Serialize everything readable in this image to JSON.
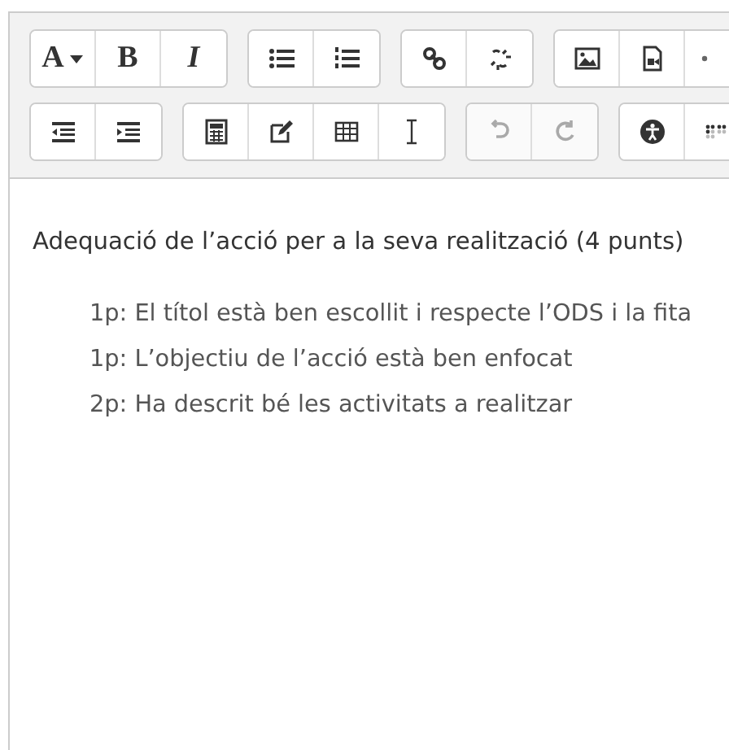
{
  "toolbar": {
    "rows": [
      [
        {
          "buttons": [
            {
              "kind": "font-menu",
              "label": "A",
              "disabled": false
            },
            {
              "kind": "bold",
              "label": "B",
              "disabled": false
            },
            {
              "kind": "italic",
              "label": "I",
              "disabled": false
            }
          ]
        },
        {
          "buttons": [
            {
              "kind": "bullet-list",
              "disabled": false
            },
            {
              "kind": "numbered-list",
              "disabled": false
            }
          ]
        },
        {
          "buttons": [
            {
              "kind": "link",
              "disabled": false
            },
            {
              "kind": "unlink",
              "disabled": false
            }
          ]
        },
        {
          "buttons": [
            {
              "kind": "image",
              "disabled": false
            },
            {
              "kind": "media",
              "disabled": false
            },
            {
              "kind": "more",
              "disabled": false
            }
          ]
        }
      ],
      [
        {
          "buttons": [
            {
              "kind": "outdent",
              "disabled": false
            },
            {
              "kind": "indent",
              "disabled": false
            }
          ]
        },
        {
          "buttons": [
            {
              "kind": "calculator",
              "disabled": false
            },
            {
              "kind": "edit",
              "disabled": false
            },
            {
              "kind": "table",
              "disabled": false
            },
            {
              "kind": "cursor",
              "disabled": false
            }
          ]
        },
        {
          "buttons": [
            {
              "kind": "undo",
              "disabled": true
            },
            {
              "kind": "redo",
              "disabled": true
            }
          ]
        },
        {
          "buttons": [
            {
              "kind": "accessibility",
              "disabled": false
            },
            {
              "kind": "braille",
              "disabled": false
            }
          ]
        }
      ]
    ]
  },
  "content": {
    "heading": "Adequació de l’acció per a la seva realització (4 punts)",
    "items": [
      "1p: El títol està ben escollit i respecte l’ODS i la fita",
      "1p: L’objectiu de l’acció està ben enfocat",
      "2p: Ha descrit bé les activitats a realitzar"
    ]
  }
}
